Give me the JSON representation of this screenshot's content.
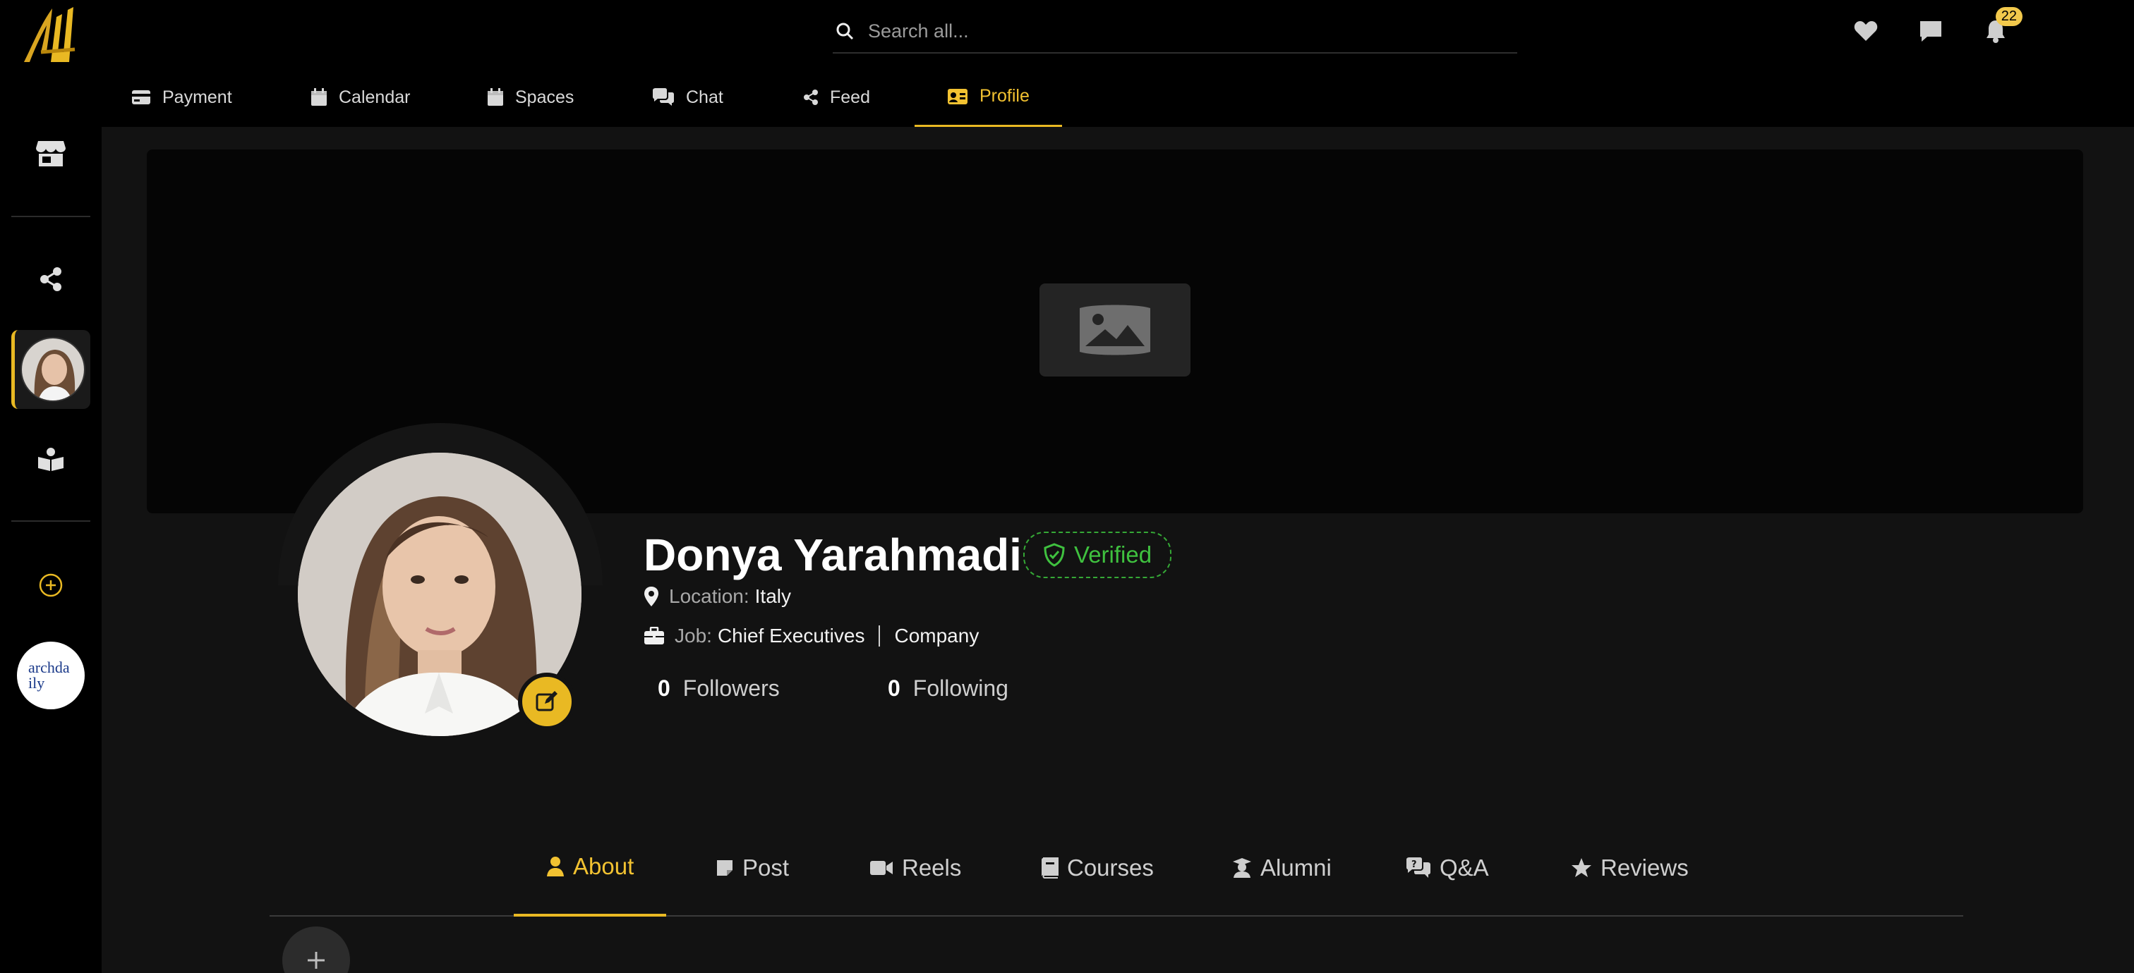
{
  "header": {
    "search_placeholder": "Search all...",
    "notification_count": "22"
  },
  "sidebar": {
    "brand_label": "archdaily"
  },
  "main_nav": {
    "tabs": [
      {
        "label": "Payment",
        "icon": "credit-card-icon"
      },
      {
        "label": "Calendar",
        "icon": "calendar-icon"
      },
      {
        "label": "Spaces",
        "icon": "calendar-icon"
      },
      {
        "label": "Chat",
        "icon": "chat-icon"
      },
      {
        "label": "Feed",
        "icon": "share-icon"
      },
      {
        "label": "Profile",
        "icon": "id-card-icon"
      }
    ],
    "active_tab": "Profile"
  },
  "profile": {
    "name": "Donya Yarahmadi",
    "verified_label": "Verified",
    "location_label": "Location:",
    "location_value": "Italy",
    "job_label": "Job:",
    "job_value": "Chief Executives",
    "company_value": "Company",
    "followers_count": "0",
    "followers_label": "Followers",
    "following_count": "0",
    "following_label": "Following"
  },
  "profile_tabs": {
    "tabs": [
      {
        "label": "About",
        "icon": "user-icon"
      },
      {
        "label": "Post",
        "icon": "note-icon"
      },
      {
        "label": "Reels",
        "icon": "video-icon"
      },
      {
        "label": "Courses",
        "icon": "book-icon"
      },
      {
        "label": "Alumni",
        "icon": "graduate-icon"
      },
      {
        "label": "Q&A",
        "icon": "comments-question-icon"
      },
      {
        "label": "Reviews",
        "icon": "star-icon"
      }
    ],
    "active_tab": "About"
  },
  "colors": {
    "accent": "#e9b923",
    "verified": "#3fc13f",
    "background": "#121212",
    "sidebar": "#000000"
  }
}
